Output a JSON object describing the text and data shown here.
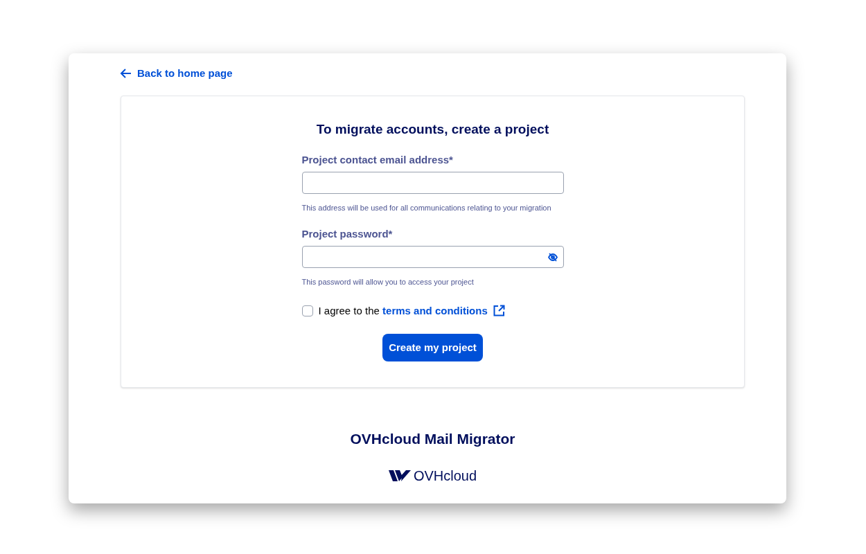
{
  "back_link": "Back to home page",
  "form": {
    "title": "To migrate accounts, create a project",
    "fields": [
      {
        "kind": "email",
        "label": "Project contact email address*",
        "help": "This address will be used for all communications relating to your migration"
      },
      {
        "kind": "password",
        "label": "Project password*",
        "help": "This password will allow you to access your project"
      }
    ],
    "agreement": {
      "checked": false,
      "text": "I agree to the",
      "link": "terms and conditions"
    },
    "submit": "Create my project"
  },
  "footer": {
    "title": "OVHcloud Mail Migrator",
    "logo_text": "OVHcloud"
  }
}
